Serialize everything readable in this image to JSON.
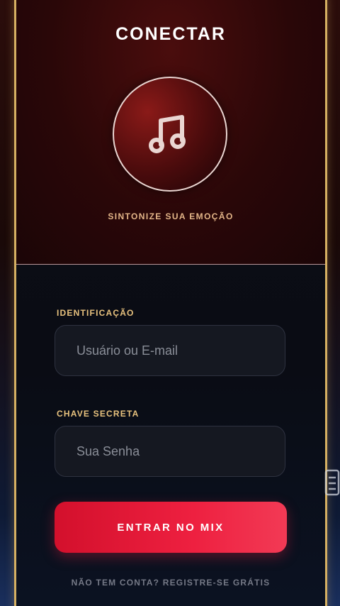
{
  "title": "CONECTAR",
  "logo_icon": "music-note-icon",
  "tagline": "SINTONIZE SUA EMOÇÃO",
  "form": {
    "username_label": "IDENTIFICAÇÃO",
    "username_placeholder": "Usuário ou E-mail",
    "username_value": "",
    "password_label": "CHAVE SECRETA",
    "password_placeholder": "Sua Senha",
    "password_value": ""
  },
  "submit_label": "ENTRAR NO MIX",
  "signup_link": "NÃO TEM CONTA? REGISTRE-SE GRÁTIS",
  "colors": {
    "accent_gold": "#d6b062",
    "button_red": "#e11a35",
    "label_gold": "#e8c27e",
    "tagline_peach": "#e3b588"
  }
}
